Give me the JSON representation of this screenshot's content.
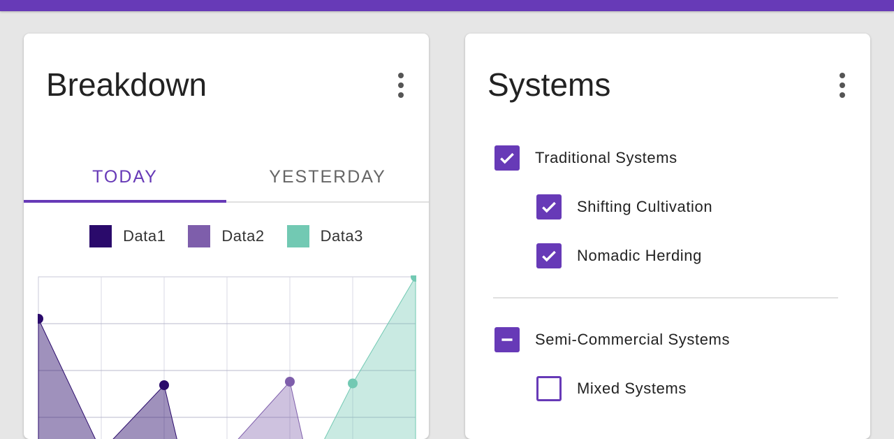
{
  "colors": {
    "accent": "#673ab7",
    "data1": "#2a0a6b",
    "data2": "#7e5eab",
    "data3": "#72c9b3"
  },
  "breakdown": {
    "title": "Breakdown",
    "menu_icon": "more-vert-icon",
    "tabs": [
      {
        "label": "TODAY",
        "active": true
      },
      {
        "label": "YESTERDAY",
        "active": false
      }
    ],
    "legend": [
      "Data1",
      "Data2",
      "Data3"
    ]
  },
  "chart_data": {
    "type": "area",
    "x": [
      0,
      1,
      2,
      3,
      4,
      5,
      6
    ],
    "grid": true,
    "ylim": [
      0,
      100
    ],
    "series": [
      {
        "name": "Data1",
        "values": [
          76,
          0,
          38,
          null,
          null,
          null,
          null
        ]
      },
      {
        "name": "Data2",
        "values": [
          null,
          null,
          null,
          0,
          40,
          null,
          null
        ]
      },
      {
        "name": "Data3",
        "values": [
          null,
          null,
          null,
          null,
          null,
          39,
          100
        ]
      }
    ]
  },
  "systems": {
    "title": "Systems",
    "menu_icon": "more-vert-icon",
    "items": [
      {
        "label": "Traditional Systems",
        "state": "checked",
        "level": 0
      },
      {
        "label": "Shifting Cultivation",
        "state": "checked",
        "level": 1
      },
      {
        "label": "Nomadic Herding",
        "state": "checked",
        "level": 1
      },
      {
        "label": "Semi-Commercial Systems",
        "state": "indeterminate",
        "level": 0
      },
      {
        "label": "Mixed Systems",
        "state": "unchecked",
        "level": 1
      }
    ]
  }
}
